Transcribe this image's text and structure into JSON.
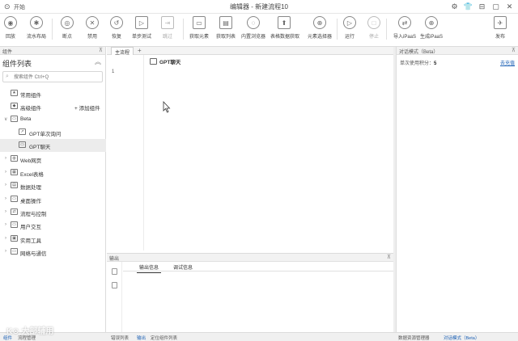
{
  "titlebar": {
    "back": "⊙",
    "start": "开始",
    "title": "编辑器 - 新建流程10",
    "controls": [
      "⚙",
      "👕",
      "⊟",
      "▢",
      "✕"
    ]
  },
  "toolbar": {
    "buttons": [
      {
        "label": "回放",
        "icon": "◉"
      },
      {
        "label": "流水布局",
        "icon": "✱"
      },
      {
        "label": "断点",
        "icon": "◎"
      },
      {
        "label": "禁用",
        "icon": "✕"
      },
      {
        "label": "恢复",
        "icon": "↺"
      },
      {
        "label": "单步测试",
        "icon": "▷"
      },
      {
        "label": "跳过",
        "icon": "⇥",
        "disabled": true
      },
      {
        "label": "获取元素",
        "icon": "▭"
      },
      {
        "label": "获取列表",
        "icon": "▤"
      },
      {
        "label": "内置浏览器",
        "icon": "◌"
      },
      {
        "label": "表格数据获取",
        "icon": "⬆"
      },
      {
        "label": "元素选择器",
        "icon": "⊕"
      },
      {
        "label": "运行",
        "icon": "▷"
      },
      {
        "label": "停止",
        "icon": "□",
        "disabled": true
      },
      {
        "label": "导入iPaaS",
        "icon": "⇄"
      },
      {
        "label": "生成iPaaS",
        "icon": "⊕"
      },
      {
        "label": "发布",
        "icon": "✈"
      }
    ]
  },
  "left": {
    "pane_title": "组件",
    "heading": "组件列表",
    "search_placeholder": "搜索组件 Ctrl+Q",
    "add_component": "+ 添加组件",
    "items": [
      {
        "label": "常用组件",
        "icon": "★",
        "indent": 0,
        "arrow": ""
      },
      {
        "label": "高级组件",
        "icon": "◆",
        "indent": 0,
        "arrow": ""
      },
      {
        "label": "Beta",
        "icon": "▭",
        "indent": 0,
        "arrow": "∨"
      },
      {
        "label": "GPT单次询问",
        "icon": "↗",
        "indent": 1,
        "arrow": ""
      },
      {
        "label": "GPT聊天",
        "icon": "▭",
        "indent": 1,
        "arrow": "",
        "selected": true
      },
      {
        "label": "Web网页",
        "icon": "◍",
        "indent": 0,
        "arrow": "›"
      },
      {
        "label": "Excel表格",
        "icon": "▦",
        "indent": 0,
        "arrow": "›"
      },
      {
        "label": "数据处理",
        "icon": "▤",
        "indent": 0,
        "arrow": "›"
      },
      {
        "label": "桌面操作",
        "icon": "▭",
        "indent": 0,
        "arrow": "›"
      },
      {
        "label": "流程与控制",
        "icon": "⇄",
        "indent": 0,
        "arrow": "›"
      },
      {
        "label": "用户交互",
        "icon": "▭",
        "indent": 0,
        "arrow": "›"
      },
      {
        "label": "实用工具",
        "icon": "▣",
        "indent": 0,
        "arrow": "›"
      },
      {
        "label": "网络与通信",
        "icon": "▭",
        "indent": 0,
        "arrow": "›"
      }
    ]
  },
  "editor": {
    "tab": "主流程",
    "add_tab": "+",
    "line_number": "1",
    "node_label": "GPT聊天"
  },
  "right": {
    "pane_title": "对话模式（Beta）",
    "usage_label": "单次使用积分：",
    "usage_value": "5",
    "link": "去充值"
  },
  "output": {
    "pane_title": "输出",
    "tabs": [
      "输出信息",
      "调试信息"
    ]
  },
  "statusbar": {
    "left": [
      "组件",
      "流程管理"
    ],
    "center": [
      "错误列表",
      "输出",
      "定位组件列表"
    ],
    "right": [
      "数据资源管理器",
      "对话模式（Beta）"
    ]
  },
  "watermark": "K⊙ 大部辅用"
}
